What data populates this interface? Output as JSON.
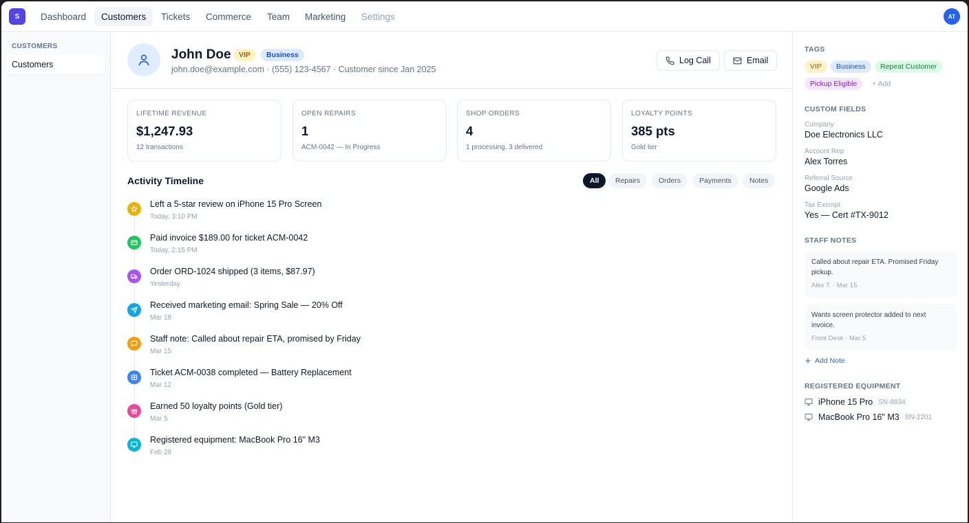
{
  "app": {
    "logo_letter": "S",
    "user_initials": "AT"
  },
  "nav": [
    {
      "label": "Dashboard"
    },
    {
      "label": "Customers"
    },
    {
      "label": "Tickets"
    },
    {
      "label": "Commerce"
    },
    {
      "label": "Team"
    },
    {
      "label": "Marketing"
    },
    {
      "label": "Settings"
    }
  ],
  "sidebar": {
    "section": "CUSTOMERS",
    "items": [
      {
        "label": "Customers"
      }
    ]
  },
  "profile": {
    "name": "John Doe",
    "badges": [
      {
        "label": "VIP"
      },
      {
        "label": "Business"
      }
    ],
    "subtitle": "john.doe@example.com · (555) 123-4567 · Customer since Jan 2025",
    "actions": {
      "log_call": "Log Call",
      "email": "Email"
    }
  },
  "stats": [
    {
      "label": "LIFETIME REVENUE",
      "value": "$1,247.93",
      "sub": "12 transactions"
    },
    {
      "label": "OPEN REPAIRS",
      "value": "1",
      "sub": "ACM-0042 — In Progress"
    },
    {
      "label": "SHOP ORDERS",
      "value": "4",
      "sub": "1 processing, 3 delivered"
    },
    {
      "label": "LOYALTY POINTS",
      "value": "385 pts",
      "sub": "Gold tier"
    }
  ],
  "timeline": {
    "title": "Activity Timeline",
    "filters": [
      {
        "label": "All"
      },
      {
        "label": "Repairs"
      },
      {
        "label": "Orders"
      },
      {
        "label": "Payments"
      },
      {
        "label": "Notes"
      }
    ],
    "items": [
      {
        "text": "Left a 5-star review on iPhone 15 Pro Screen",
        "time": "Today, 3:10 PM",
        "icon": "star-icon",
        "color": "#eab308"
      },
      {
        "text": "Paid invoice $189.00 for ticket ACM-0042",
        "time": "Today, 2:15 PM",
        "icon": "credit-card-icon",
        "color": "#22c55e"
      },
      {
        "text": "Order ORD-1024 shipped (3 items, $87.97)",
        "time": "Yesterday",
        "icon": "truck-icon",
        "color": "#a855f7"
      },
      {
        "text": "Received marketing email: Spring Sale — 20% Off",
        "time": "Mar 18",
        "icon": "send-icon",
        "color": "#0ea5e9"
      },
      {
        "text": "Staff note: Called about repair ETA, promised by Friday",
        "time": "Mar 15",
        "icon": "message-icon",
        "color": "#f59e0b"
      },
      {
        "text": "Ticket ACM-0038 completed — Battery Replacement",
        "time": "Mar 12",
        "icon": "ticket-icon",
        "color": "#3b82f6"
      },
      {
        "text": "Earned 50 loyalty points (Gold tier)",
        "time": "Mar 5",
        "icon": "gift-icon",
        "color": "#ec4899"
      },
      {
        "text": "Registered equipment: MacBook Pro 16\" M3",
        "time": "Feb 28",
        "icon": "monitor-icon",
        "color": "#06b6d4"
      }
    ]
  },
  "right": {
    "tags_title": "TAGS",
    "tags": [
      {
        "label": "VIP",
        "bg": "#fef3c7",
        "fg": "#a16207"
      },
      {
        "label": "Business",
        "bg": "#dbeafe",
        "fg": "#1d4ed8"
      },
      {
        "label": "Repeat Customer",
        "bg": "#dcfce7",
        "fg": "#15803d"
      },
      {
        "label": "Pickup Eligible",
        "bg": "#f3e8ff",
        "fg": "#7e22ce"
      }
    ],
    "add_tag": "+ Add",
    "custom_fields_title": "CUSTOM FIELDS",
    "custom_fields": [
      {
        "label": "Company",
        "value": "Doe Electronics LLC"
      },
      {
        "label": "Account Rep",
        "value": "Alex Torres"
      },
      {
        "label": "Referral Source",
        "value": "Google Ads"
      },
      {
        "label": "Tax Exempt",
        "value": "Yes — Cert #TX-9012"
      }
    ],
    "staff_notes_title": "STAFF NOTES",
    "staff_notes": [
      {
        "text": "Called about repair ETA. Promised Friday pickup.",
        "meta": "Alex T. · Mar 15"
      },
      {
        "text": "Wants screen protector added to next invoice.",
        "meta": "Front Desk · Mar 5"
      }
    ],
    "add_note": "Add Note",
    "equipment_title": "REGISTERED EQUIPMENT",
    "equipment": [
      {
        "name": "iPhone 15 Pro",
        "sn": "SN-8834"
      },
      {
        "name": "MacBook Pro 16\" M3",
        "sn": "SN-2201"
      }
    ]
  }
}
